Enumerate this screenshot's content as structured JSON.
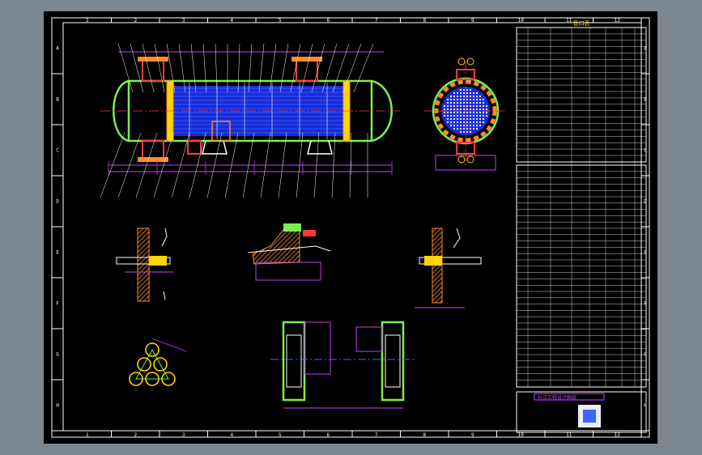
{
  "drawing": {
    "background": "#000000",
    "frame_color": "#ffffff",
    "colors": {
      "outline": "#ffffff",
      "shell": "#7cf04a",
      "tube_fill": "#1a2bd8",
      "tube_lines": "#3d66ff",
      "dimension": "#c040ff",
      "leader": "#ffffff",
      "hatch": "#ff8a2a",
      "nozzle": "#ff3b3b",
      "yellow": "#ffd400",
      "cyan": "#40e0ff"
    },
    "col_zone_labels": [
      "1",
      "2",
      "3",
      "4",
      "5",
      "6",
      "7",
      "8",
      "9",
      "10",
      "11",
      "12"
    ],
    "row_zone_labels": [
      "A",
      "B",
      "C",
      "D",
      "E",
      "F",
      "G",
      "H"
    ],
    "title_table_header": "管口表",
    "title_block_stamp": "长江工程设计图纸"
  }
}
